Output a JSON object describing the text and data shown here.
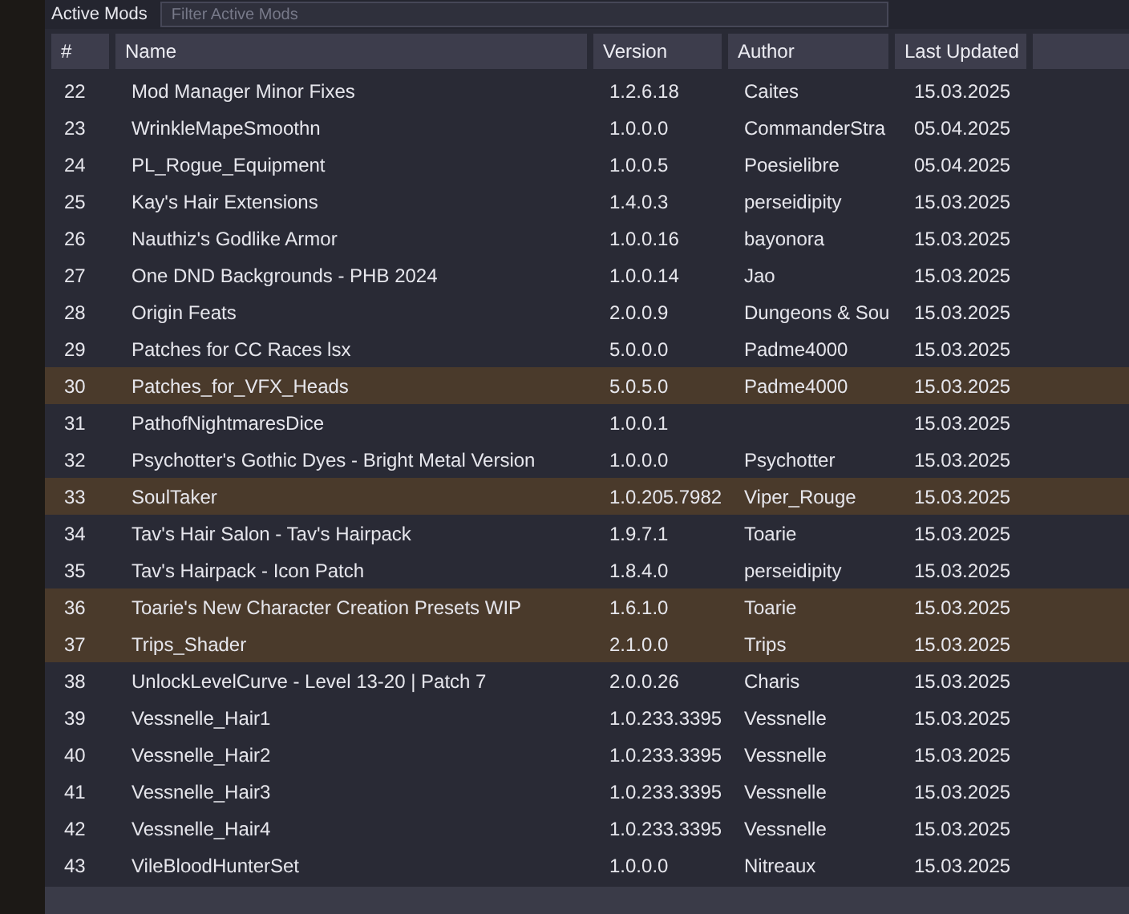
{
  "section": {
    "title": "Active Mods",
    "filter": {
      "placeholder": "Filter Active Mods"
    }
  },
  "table": {
    "columns": [
      "#",
      "Name",
      "Version",
      "Author",
      "Last Updated",
      ""
    ],
    "rows": [
      {
        "index": "22",
        "name": "Mod Manager Minor Fixes",
        "version": "1.2.6.18",
        "author": "Caites",
        "updated": "15.03.2025",
        "selected": false
      },
      {
        "index": "23",
        "name": "WrinkleMapeSmoothn",
        "version": "1.0.0.0",
        "author": "CommanderStra",
        "updated": "05.04.2025",
        "selected": false
      },
      {
        "index": "24",
        "name": "PL_Rogue_Equipment",
        "version": "1.0.0.5",
        "author": "Poesielibre",
        "updated": "05.04.2025",
        "selected": false
      },
      {
        "index": "25",
        "name": "Kay's Hair Extensions",
        "version": "1.4.0.3",
        "author": "perseidipity",
        "updated": "15.03.2025",
        "selected": false
      },
      {
        "index": "26",
        "name": "Nauthiz's Godlike Armor",
        "version": "1.0.0.16",
        "author": "bayonora",
        "updated": "15.03.2025",
        "selected": false
      },
      {
        "index": "27",
        "name": "One DND Backgrounds - PHB 2024",
        "version": "1.0.0.14",
        "author": "Jao",
        "updated": "15.03.2025",
        "selected": false
      },
      {
        "index": "28",
        "name": "Origin Feats",
        "version": "2.0.0.9",
        "author": "Dungeons & Sou",
        "updated": "15.03.2025",
        "selected": false
      },
      {
        "index": "29",
        "name": "Patches for CC Races lsx",
        "version": "5.0.0.0",
        "author": "Padme4000",
        "updated": "15.03.2025",
        "selected": false
      },
      {
        "index": "30",
        "name": "Patches_for_VFX_Heads",
        "version": "5.0.5.0",
        "author": "Padme4000",
        "updated": "15.03.2025",
        "selected": true
      },
      {
        "index": "31",
        "name": "PathofNightmaresDice",
        "version": "1.0.0.1",
        "author": "",
        "updated": "15.03.2025",
        "selected": false
      },
      {
        "index": "32",
        "name": "Psychotter's Gothic Dyes - Bright Metal Version",
        "version": "1.0.0.0",
        "author": "Psychotter",
        "updated": "15.03.2025",
        "selected": false
      },
      {
        "index": "33",
        "name": "SoulTaker",
        "version": "1.0.205.7982",
        "author": "Viper_Rouge",
        "updated": "15.03.2025",
        "selected": true
      },
      {
        "index": "34",
        "name": "Tav's Hair Salon - Tav's Hairpack",
        "version": "1.9.7.1",
        "author": "Toarie",
        "updated": "15.03.2025",
        "selected": false
      },
      {
        "index": "35",
        "name": "Tav's Hairpack - Icon Patch",
        "version": "1.8.4.0",
        "author": "perseidipity",
        "updated": "15.03.2025",
        "selected": false
      },
      {
        "index": "36",
        "name": "Toarie's New Character Creation Presets WIP",
        "version": "1.6.1.0",
        "author": "Toarie",
        "updated": "15.03.2025",
        "selected": true
      },
      {
        "index": "37",
        "name": "Trips_Shader",
        "version": "2.1.0.0",
        "author": "Trips",
        "updated": "15.03.2025",
        "selected": true
      },
      {
        "index": "38",
        "name": "UnlockLevelCurve - Level 13-20 | Patch 7",
        "version": "2.0.0.26",
        "author": "Charis",
        "updated": "15.03.2025",
        "selected": false
      },
      {
        "index": "39",
        "name": "Vessnelle_Hair1",
        "version": "1.0.233.3395",
        "author": "Vessnelle",
        "updated": "15.03.2025",
        "selected": false
      },
      {
        "index": "40",
        "name": "Vessnelle_Hair2",
        "version": "1.0.233.3395",
        "author": "Vessnelle",
        "updated": "15.03.2025",
        "selected": false
      },
      {
        "index": "41",
        "name": "Vessnelle_Hair3",
        "version": "1.0.233.3395",
        "author": "Vessnelle",
        "updated": "15.03.2025",
        "selected": false
      },
      {
        "index": "42",
        "name": "Vessnelle_Hair4",
        "version": "1.0.233.3395",
        "author": "Vessnelle",
        "updated": "15.03.2025",
        "selected": false
      },
      {
        "index": "43",
        "name": "VileBloodHunterSet",
        "version": "1.0.0.0",
        "author": "Nitreaux",
        "updated": "15.03.2025",
        "selected": false
      }
    ]
  }
}
